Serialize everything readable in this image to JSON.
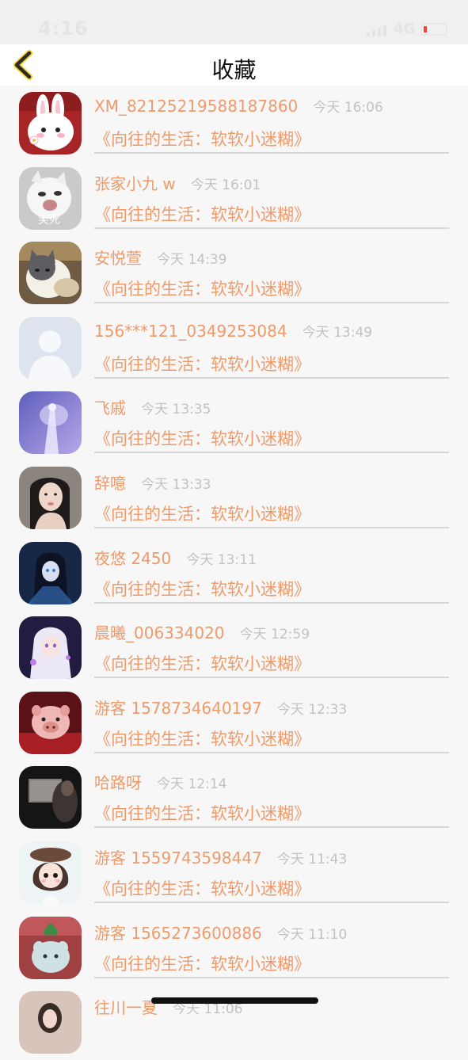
{
  "status_bar": {
    "time": "4:16",
    "network": "4G",
    "battery_color": "#ff3b30"
  },
  "header": {
    "title": "收藏",
    "back_icon": "chevron-left-icon",
    "accent": "#f6d21d"
  },
  "items": [
    {
      "name": "XM_8212521958818​7860",
      "time": "今天 16:06",
      "title": "《向往的生活：软软小迷糊》",
      "avatar": "white-rabbit"
    },
    {
      "name": "张家小九 w",
      "time": "今天 16:01",
      "title": "《向往的生活：软软小迷糊》",
      "avatar": "laughing-cat",
      "avatar_text": "笑死"
    },
    {
      "name": "安悦萱",
      "time": "今天 14:39",
      "title": "《向往的生活：软软小迷糊》",
      "avatar": "cat-photo"
    },
    {
      "name": "156***121_0349253084",
      "time": "今天 13:49",
      "title": "《向往的生活：软软小迷糊》",
      "avatar": "default-person"
    },
    {
      "name": "飞戚",
      "time": "今天 13:35",
      "title": "《向往的生活：软软小迷糊》",
      "avatar": "purple-figure"
    },
    {
      "name": "辞噫",
      "time": "今天 13:33",
      "title": "《向往的生活：软软小迷糊》",
      "avatar": "girl-portrait"
    },
    {
      "name": "夜悠 2450",
      "time": "今天 13:11",
      "title": "《向往的生活：软软小迷糊》",
      "avatar": "anime-dark"
    },
    {
      "name": "晨曦_006334020",
      "time": "今天 12:59",
      "title": "《向往的生活：软软小迷糊》",
      "avatar": "anime-white-hair"
    },
    {
      "name": "游客 1578734640197",
      "time": "今天 12:33",
      "title": "《向往的生活：软软小迷糊》",
      "avatar": "pig-toy"
    },
    {
      "name": "哈路呀",
      "time": "今天 12:14",
      "title": "《向往的生活：软软小迷糊》",
      "avatar": "car-photo"
    },
    {
      "name": "游客 1559743598447",
      "time": "今天 11:43",
      "title": "《向往的生活：软软小迷糊》",
      "avatar": "chibi-girl"
    },
    {
      "name": "游客 1565273600886",
      "time": "今天 11:10",
      "title": "《向往的生活：软软小迷糊》",
      "avatar": "clover-toy"
    },
    {
      "name": "往川一夏",
      "time": "今天 11:06",
      "title": "",
      "avatar": "girl-photo"
    }
  ]
}
